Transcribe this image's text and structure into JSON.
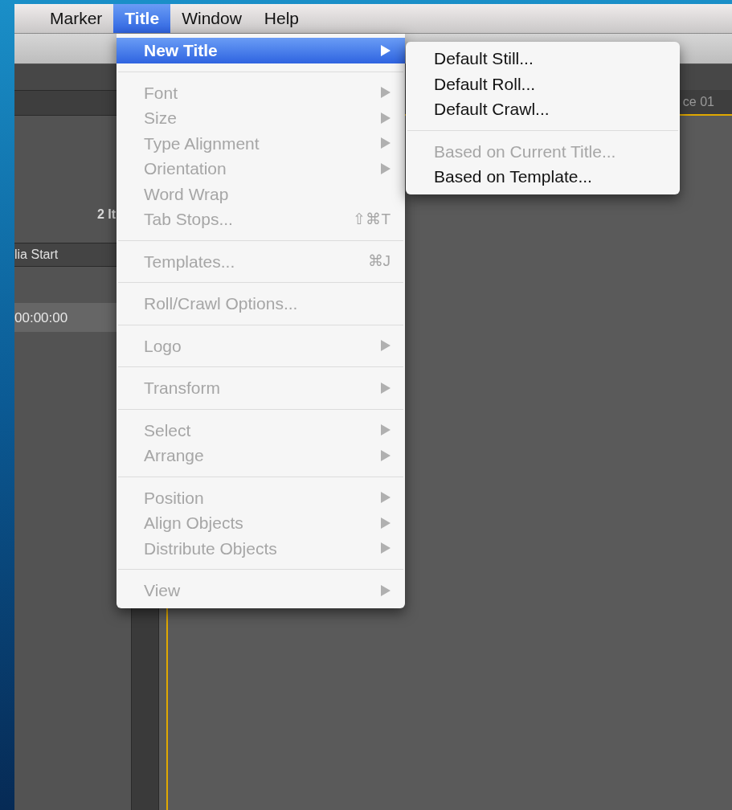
{
  "menu_bar": [
    {
      "label": "Marker",
      "selected": false
    },
    {
      "label": "Title",
      "selected": true
    },
    {
      "label": "Window",
      "selected": false
    },
    {
      "label": "Help",
      "selected": false
    }
  ],
  "title_menu": {
    "groups": [
      [
        {
          "label": "New Title",
          "submenu": true,
          "disabled": false,
          "selected": true
        }
      ],
      [
        {
          "label": "Font",
          "submenu": true,
          "disabled": true,
          "selected": false
        },
        {
          "label": "Size",
          "submenu": true,
          "disabled": true,
          "selected": false
        },
        {
          "label": "Type Alignment",
          "submenu": true,
          "disabled": true,
          "selected": false
        },
        {
          "label": "Orientation",
          "submenu": true,
          "disabled": true,
          "selected": false
        },
        {
          "label": "Word Wrap",
          "submenu": false,
          "disabled": true,
          "selected": false
        },
        {
          "label": "Tab Stops...",
          "submenu": false,
          "disabled": true,
          "selected": false,
          "shortcut": "⇧⌘T"
        }
      ],
      [
        {
          "label": "Templates...",
          "submenu": false,
          "disabled": true,
          "selected": false,
          "shortcut": "⌘J"
        }
      ],
      [
        {
          "label": "Roll/Crawl Options...",
          "submenu": false,
          "disabled": true,
          "selected": false
        }
      ],
      [
        {
          "label": "Logo",
          "submenu": true,
          "disabled": true,
          "selected": false
        }
      ],
      [
        {
          "label": "Transform",
          "submenu": true,
          "disabled": true,
          "selected": false
        }
      ],
      [
        {
          "label": "Select",
          "submenu": true,
          "disabled": true,
          "selected": false
        },
        {
          "label": "Arrange",
          "submenu": true,
          "disabled": true,
          "selected": false
        }
      ],
      [
        {
          "label": "Position",
          "submenu": true,
          "disabled": true,
          "selected": false
        },
        {
          "label": "Align Objects",
          "submenu": true,
          "disabled": true,
          "selected": false
        },
        {
          "label": "Distribute Objects",
          "submenu": true,
          "disabled": true,
          "selected": false
        }
      ],
      [
        {
          "label": "View",
          "submenu": true,
          "disabled": true,
          "selected": false
        }
      ]
    ]
  },
  "new_title_submenu": {
    "groups": [
      [
        {
          "label": "Default Still...",
          "disabled": false
        },
        {
          "label": "Default Roll...",
          "disabled": false
        },
        {
          "label": "Default Crawl...",
          "disabled": false
        }
      ],
      [
        {
          "label": "Based on Current Title...",
          "disabled": true
        },
        {
          "label": "Based on Template...",
          "disabled": false
        }
      ]
    ]
  },
  "background": {
    "item_count": "2 It",
    "column_header": "lia Start",
    "timecode": "00:00:00",
    "tab": "ce 01"
  }
}
